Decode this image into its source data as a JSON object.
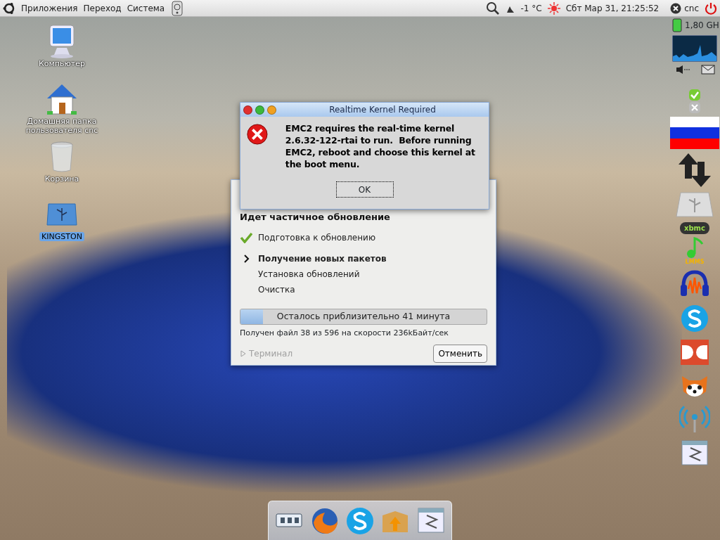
{
  "top_panel": {
    "menus": [
      {
        "label": "Приложения"
      },
      {
        "label": "Переход"
      },
      {
        "label": "Система"
      }
    ],
    "temperature": "-1 °C",
    "clock": "Сбт Мар 31, 21:25:52",
    "user": "cnc"
  },
  "desktop_icons": [
    {
      "kind": "computer",
      "label": "Компьютер",
      "selected": false
    },
    {
      "kind": "home",
      "label": "Домашняя папка пользователя cnc",
      "selected": false
    },
    {
      "kind": "trash",
      "label": "Корзина",
      "selected": false
    },
    {
      "kind": "usb",
      "label": "KINGSTON",
      "selected": true
    }
  ],
  "right_panel": {
    "cpu_frequency": "1,80 GH",
    "launchers": [
      {
        "kind": "xbmc",
        "label": "xbmc"
      },
      {
        "kind": "lmms",
        "label": "LMMS"
      },
      {
        "kind": "audacity"
      },
      {
        "kind": "skype"
      },
      {
        "kind": "doublecmd"
      },
      {
        "kind": "panda"
      },
      {
        "kind": "wireless"
      },
      {
        "kind": "window"
      }
    ]
  },
  "alert_dialog": {
    "title": "Realtime Kernel Required",
    "message": "EMC2 requires the real-time kernel 2.6.32-122-rtai to run.  Before running EMC2, reboot and choose this kernel at the boot menu.",
    "button": "OK"
  },
  "update_window": {
    "heading": "Идет частичное обновление",
    "steps": [
      {
        "label": "Подготовка к обновлению",
        "done": true,
        "current": false
      },
      {
        "label": "Получение новых пакетов",
        "done": false,
        "current": true
      },
      {
        "label": "Установка обновлений",
        "done": false,
        "current": false
      },
      {
        "label": "Очистка",
        "done": false,
        "current": false
      }
    ],
    "progress": {
      "level": 0.09,
      "text": "Осталось приблизительно 41 минута"
    },
    "detail": "Получен файл 38 из 596 на скорости 236kБайт/сек",
    "terminal": {
      "label": "Терминал",
      "expanded": false,
      "disabled": true
    },
    "cancel_button": "Отменить"
  },
  "dock": [
    {
      "kind": "hardware"
    },
    {
      "kind": "firefox"
    },
    {
      "kind": "skype"
    },
    {
      "kind": "package"
    },
    {
      "kind": "window"
    }
  ]
}
